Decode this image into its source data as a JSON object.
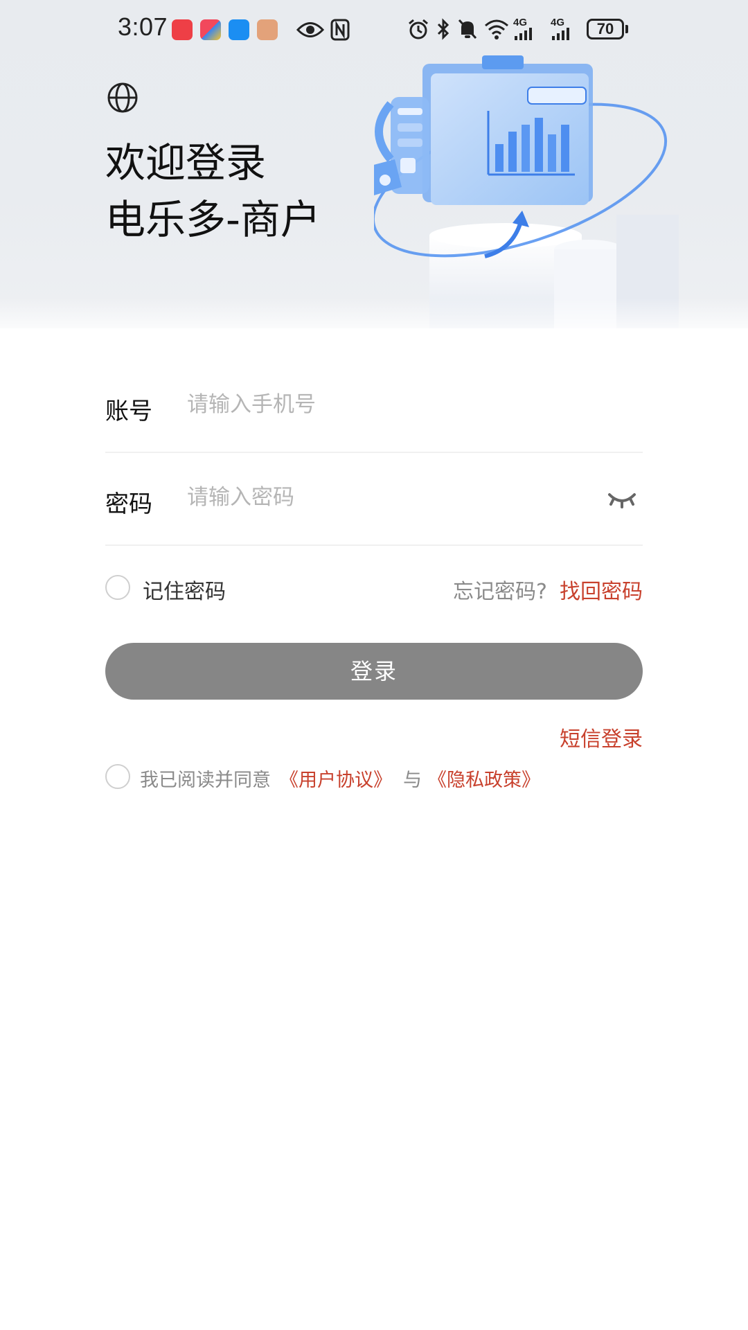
{
  "status_bar": {
    "time": "3:07",
    "battery": "70",
    "network_1": "4G",
    "network_2": "4G",
    "icons": [
      "alarm-icon",
      "bluetooth-icon",
      "mute-icon",
      "wifi-icon",
      "signal-icon",
      "signal-icon"
    ],
    "app_icons": [
      "huawei-store-icon",
      "game-app-icon",
      "message-icon",
      "chat-icon",
      "eye-icon",
      "nfc-icon"
    ]
  },
  "header": {
    "title_line1": "欢迎登录",
    "title_line2": "电乐多-商户",
    "language_icon": "globe-icon"
  },
  "form": {
    "account_label": "账号",
    "account_placeholder": "请输入手机号",
    "account_value": "",
    "password_label": "密码",
    "password_placeholder": "请输入密码",
    "password_value": "",
    "password_toggle_icon": "eye-closed-icon"
  },
  "options": {
    "remember_label": "记住密码",
    "remember_checked": false,
    "forgot_text": "忘记密码?",
    "recover_link": "找回密码"
  },
  "actions": {
    "login_label": "登录",
    "sms_login_label": "短信登录"
  },
  "agreement": {
    "checked": false,
    "prefix": "我已阅读并同意",
    "user_agreement": "《用户协议》",
    "and": "与",
    "privacy_policy": "《隐私政策》"
  },
  "colors": {
    "accent": "#c8412d",
    "button_disabled": "#868686",
    "hero_bg": "#e8ebef",
    "placeholder": "#b5b5b5"
  }
}
